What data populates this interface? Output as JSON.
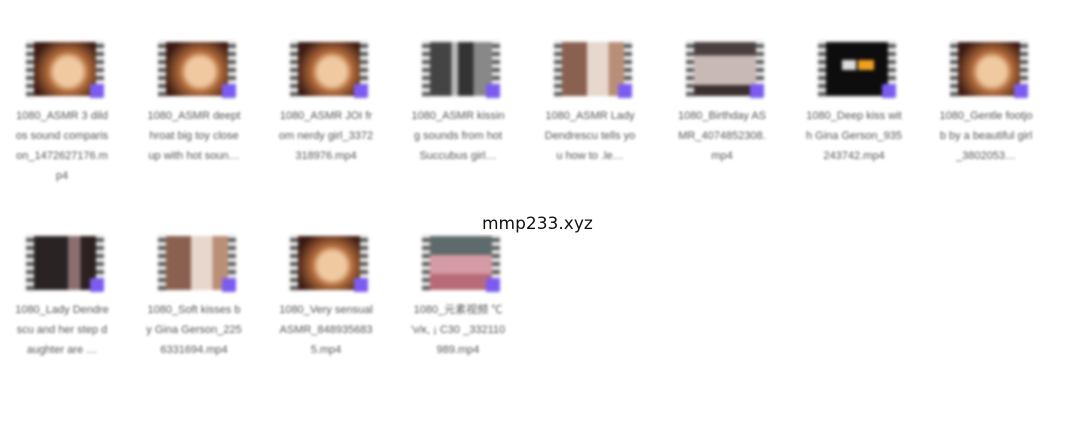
{
  "files": [
    {
      "name": "1080_ASMR 3 dildos sound comparison_1472627176.mp4",
      "thumb": "warm"
    },
    {
      "name": "1080_ASMR deepthroat big toy close up with hot soun…",
      "thumb": "warm"
    },
    {
      "name": "1080_ASMR JOI from nerdy girl_3372318976.mp4",
      "thumb": "warm"
    },
    {
      "name": "1080_ASMR kissing sounds from hot Succubus girl…",
      "thumb": "gray"
    },
    {
      "name": "1080_ASMR Lady Dendrescu tells you how to .le…",
      "thumb": "beige"
    },
    {
      "name": "1080_Birthday ASMR_4074852308.mp4",
      "thumb": "mauve"
    },
    {
      "name": "1080_Deep kiss with Gina Gerson_935243742.mp4",
      "thumb": "black"
    },
    {
      "name": "1080_Gentle footjob by a beautiful girl_3802053…",
      "thumb": "warm"
    },
    {
      "name": "1080_Lady Dendrescu and her step daughter are …",
      "thumb": "dark"
    },
    {
      "name": "1080_Soft kisses by Gina Gerson_2256331694.mp4",
      "thumb": "beige"
    },
    {
      "name": "1080_Very sensual ASMR_8489356835.mp4",
      "thumb": "warm"
    },
    {
      "name": "1080_元素视频 ℃ 'ν/ĸ, ¡ C30 _332110989.mp4",
      "thumb": "pink"
    }
  ],
  "watermark": "mmp233.xyz",
  "colors": {
    "accent_badge": "#7c5cf0"
  }
}
